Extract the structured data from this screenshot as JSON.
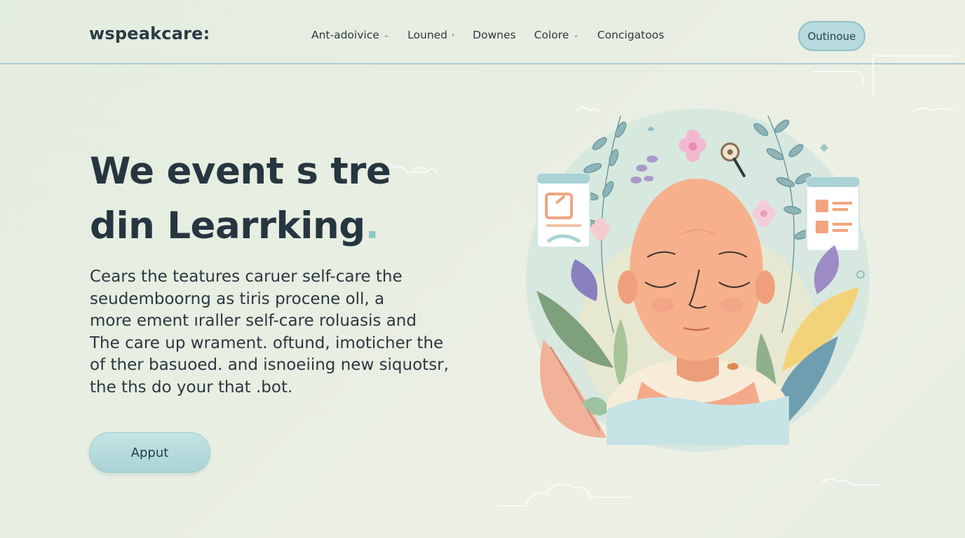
{
  "header": {
    "logo": "wspeakcare:",
    "nav": [
      {
        "label": "Ant-adoivice",
        "indicator": "⌄"
      },
      {
        "label": "Louned",
        "indicator": "›"
      },
      {
        "label": "Downes",
        "indicator": ""
      },
      {
        "label": "Colore",
        "indicator": "⌄"
      },
      {
        "label": "Concigatoos",
        "indicator": ""
      }
    ],
    "cta_label": "Outinoue"
  },
  "hero": {
    "title_line1": "We event s tre",
    "title_line2": "din Learrking",
    "title_dot": ".",
    "body_lines": [
      "Cears the teatures caruer self-care the",
      "seudemboorng as tiris procene oll, a",
      "more ement ıraller self-care roluasis and",
      "The care up wrament. oftund, imoticher the",
      "of ther basuoed. and isnoeiing new siquotsr,",
      "the ths do your that .bot."
    ],
    "cta_label": "Apput"
  },
  "colors": {
    "accent": "#a9d3d5",
    "text": "#263640",
    "face": "#f6b08c",
    "leaf": "#8aafa0",
    "lavender": "#a99ac8"
  }
}
